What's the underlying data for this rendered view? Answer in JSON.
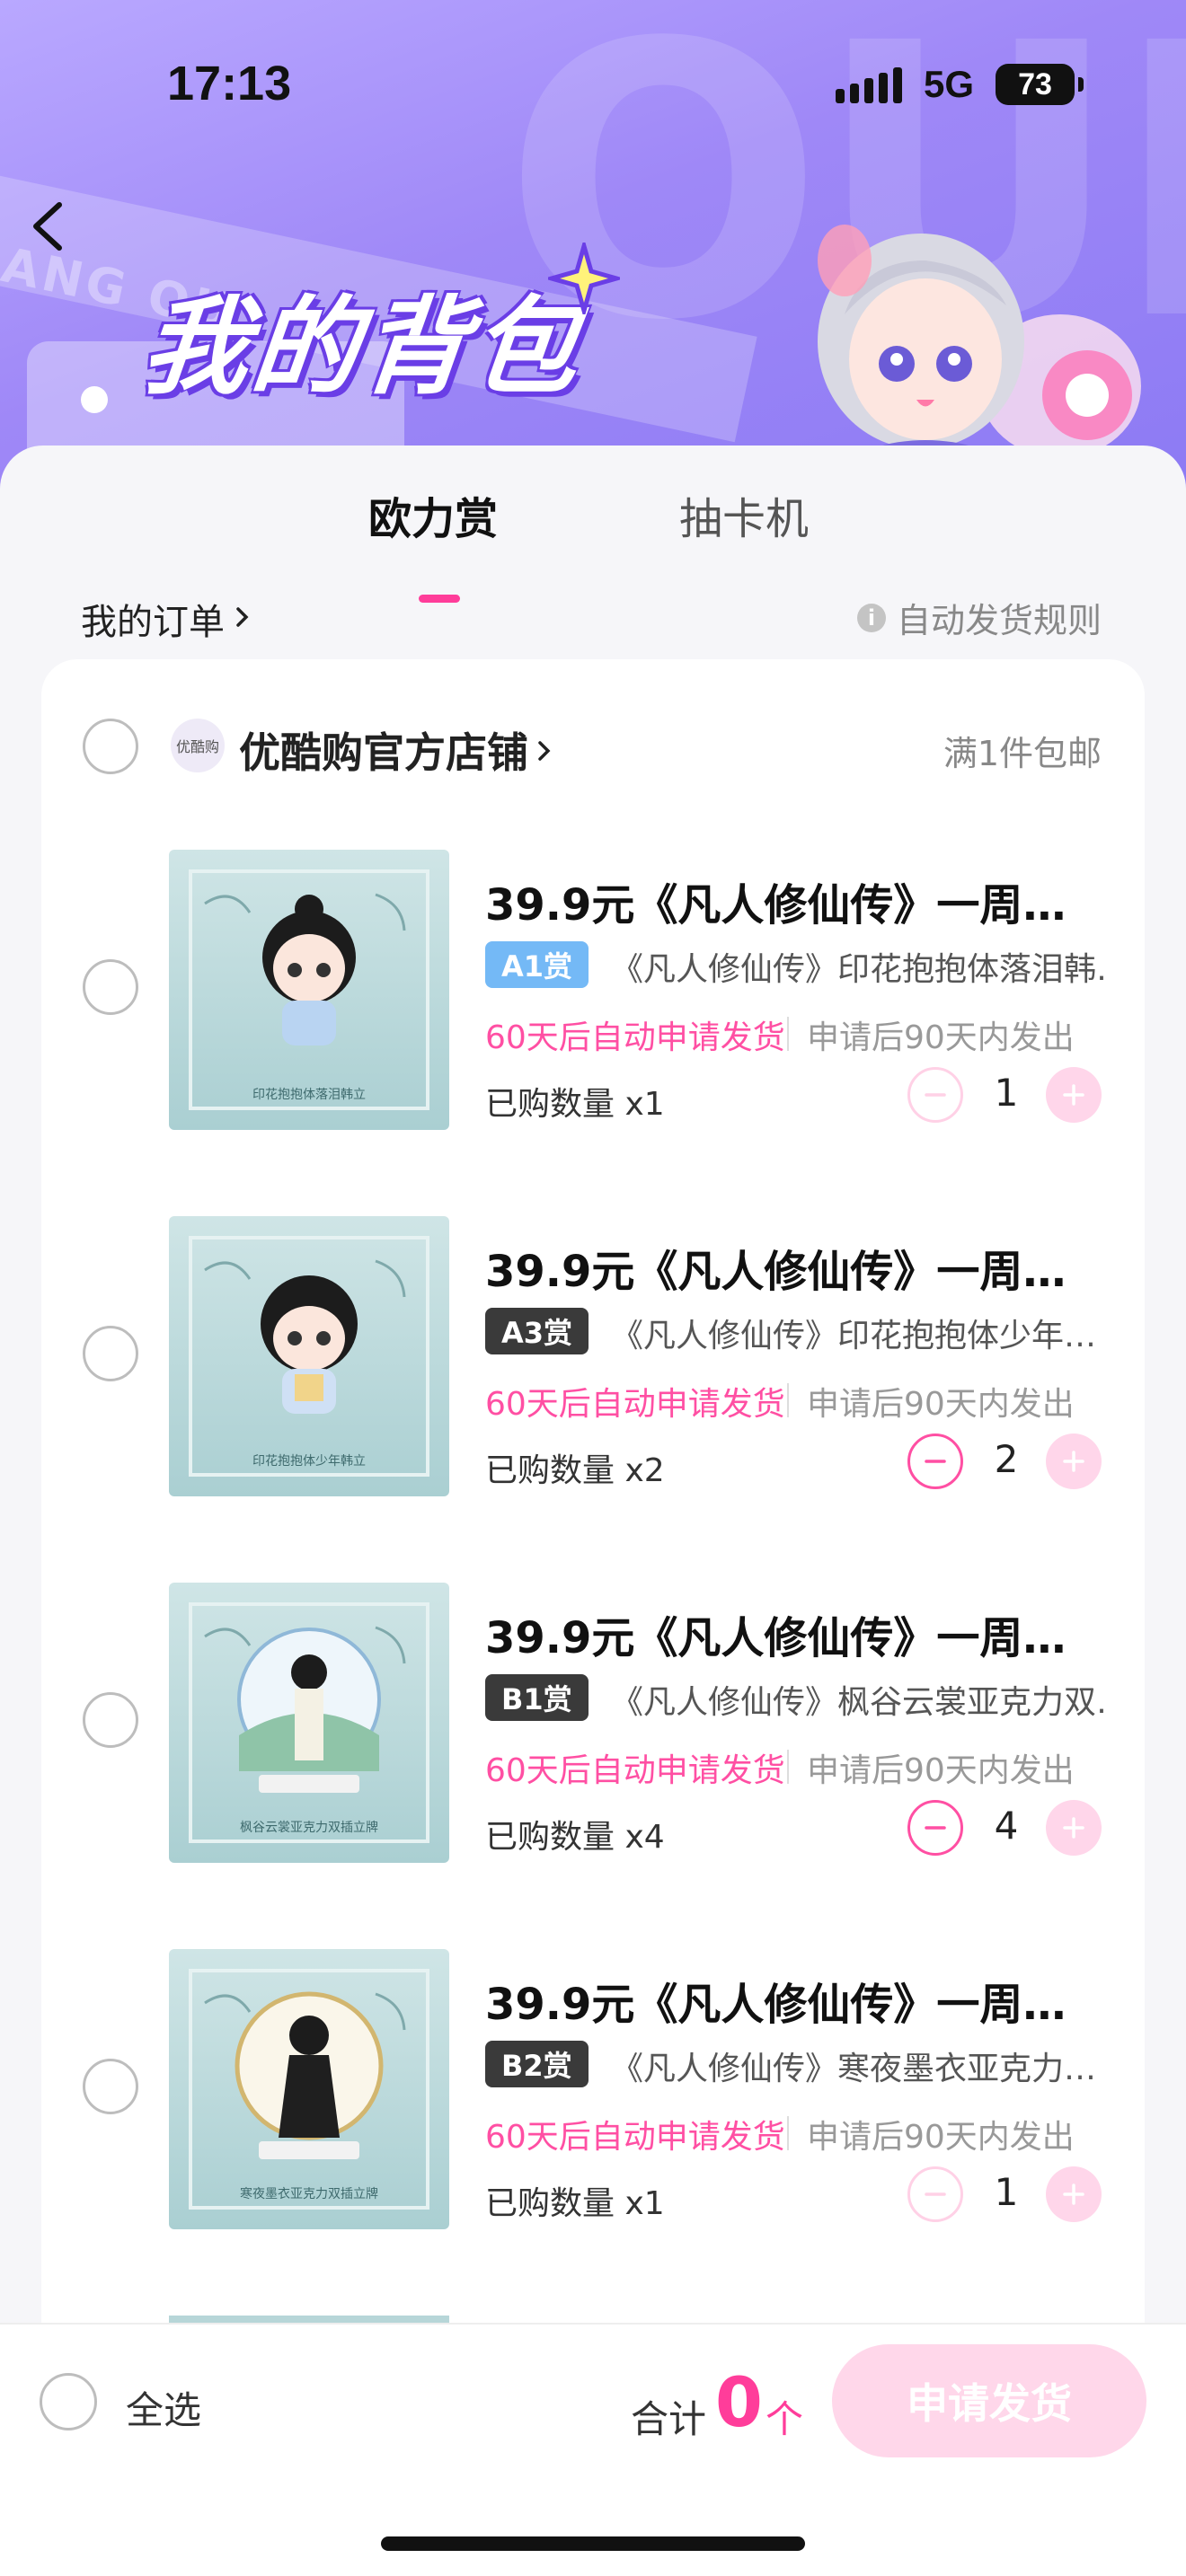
{
  "status_bar": {
    "time": "17:13",
    "network": "5G",
    "battery": "73"
  },
  "header": {
    "title": "我的背包",
    "deco_text": "OUL",
    "stripe_text": "ANG OU"
  },
  "tabs": [
    {
      "label": "欧力赏",
      "active": true
    },
    {
      "label": "抽卡机",
      "active": false
    }
  ],
  "links": {
    "my_orders": "我的订单",
    "auto_ship_rules": "自动发货规则"
  },
  "shop": {
    "logo_text": "优酷购",
    "name": "优酷购官方店铺",
    "shipping_note": "满1件包邮"
  },
  "items": [
    {
      "title": "39.9元《凡人修仙传》一周…",
      "badge": "A1赏",
      "badge_style": "blue",
      "subtitle": "《凡人修仙传》印花抱抱体落泪韩…",
      "auto_ship": "60天后自动申请发货",
      "ship_after": "申请后90天内发出",
      "qty_label": "已购数量 x1",
      "qty": "1",
      "minus_enabled": false,
      "thumb_caption": "印花抱抱体落泪韩立"
    },
    {
      "title": "39.9元《凡人修仙传》一周…",
      "badge": "A3赏",
      "badge_style": "dark",
      "subtitle": "《凡人修仙传》印花抱抱体少年…",
      "auto_ship": "60天后自动申请发货",
      "ship_after": "申请后90天内发出",
      "qty_label": "已购数量 x2",
      "qty": "2",
      "minus_enabled": true,
      "thumb_caption": "印花抱抱体少年韩立"
    },
    {
      "title": "39.9元《凡人修仙传》一周…",
      "badge": "B1赏",
      "badge_style": "dark",
      "subtitle": "《凡人修仙传》枫谷云裳亚克力双…",
      "auto_ship": "60天后自动申请发货",
      "ship_after": "申请后90天内发出",
      "qty_label": "已购数量 x4",
      "qty": "4",
      "minus_enabled": true,
      "thumb_caption": "枫谷云裳亚克力双插立牌"
    },
    {
      "title": "39.9元《凡人修仙传》一周…",
      "badge": "B2赏",
      "badge_style": "dark",
      "subtitle": "《凡人修仙传》寒夜墨衣亚克力…",
      "auto_ship": "60天后自动申请发货",
      "ship_after": "申请后90天内发出",
      "qty_label": "已购数量 x1",
      "qty": "1",
      "minus_enabled": false,
      "thumb_caption": "寒夜墨衣亚克力双插立牌"
    }
  ],
  "bottom_bar": {
    "select_all": "全选",
    "total_label": "合计",
    "total_count": "0",
    "total_unit": "个",
    "submit": "申请发货"
  },
  "colors": {
    "accent": "#ff3d9a",
    "header_purple": "#9f88f7",
    "badge_blue": "#74b9f6",
    "badge_dark": "#3a3a3a"
  },
  "icons": [
    "back-arrow-icon",
    "chevron-right-icon",
    "info-icon",
    "minus-icon",
    "plus-icon",
    "signal-icon",
    "battery-icon",
    "sparkle-icon"
  ]
}
